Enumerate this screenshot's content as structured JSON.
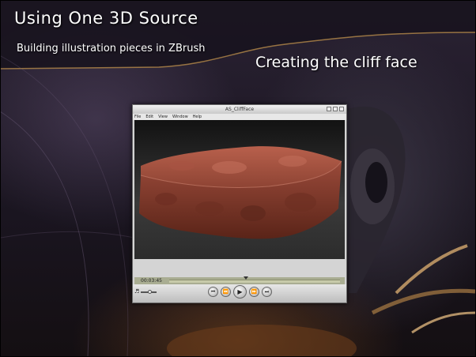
{
  "slide": {
    "title": "Using One 3D Source",
    "subtitle": "Building illustration pieces in ZBrush",
    "heading": "Creating the cliff face"
  },
  "player": {
    "window_title": "AS_CliffFace",
    "menu": [
      "File",
      "Edit",
      "View",
      "Window",
      "Help"
    ],
    "timecode": "00:03:45",
    "progress": 0.45,
    "volume": 0.6,
    "controls": {
      "skip_back_icon": "skip-to-start-icon",
      "rewind_icon": "rewind-icon",
      "play_icon": "play-icon",
      "fast_forward_icon": "fast-forward-icon",
      "skip_forward_icon": "skip-to-end-icon"
    }
  },
  "colors": {
    "clay": "#9a4a3a",
    "clay_shadow": "#5a2418",
    "timeline": "#a9ad92"
  }
}
